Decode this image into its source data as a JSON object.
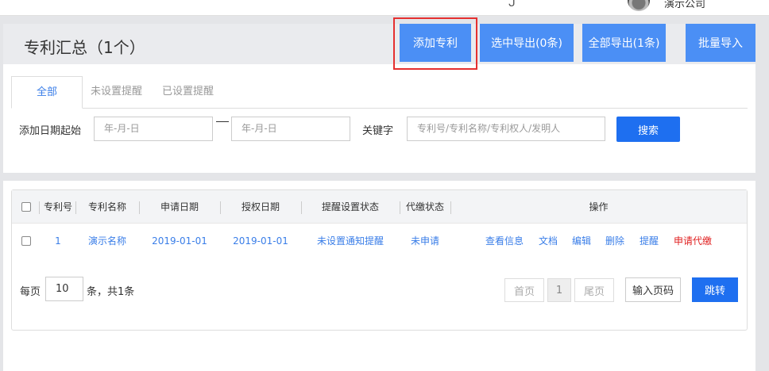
{
  "topbar": {
    "company": "演示公司"
  },
  "header": {
    "title": "专利汇总（1个）",
    "add_button": "添加专利",
    "export_selected": "选中导出(0条)",
    "export_all": "全部导出(1条)",
    "batch_import": "批量导入"
  },
  "tabs": [
    "全部",
    "未设置提醒",
    "已设置提醒"
  ],
  "filters": {
    "date_label": "添加日期起始",
    "date_from_placeholder": "年-月-日",
    "date_to_placeholder": "年-月-日",
    "keyword_label": "关键字",
    "keyword_placeholder": "专利号/专利名称/专利权人/发明人",
    "search_button": "搜索"
  },
  "table": {
    "columns": [
      "专利号",
      "专利名称",
      "申请日期",
      "授权日期",
      "提醒设置状态",
      "代缴状态",
      "操作"
    ],
    "rows": [
      {
        "number": "1",
        "name": "演示名称",
        "apply_date": "2019-01-01",
        "grant_date": "2019-01-01",
        "reminder_status": "未设置通知提醒",
        "payment_status": "未申请",
        "actions": [
          "查看信息",
          "文档",
          "编辑",
          "删除",
          "提醒",
          "申请代缴"
        ]
      }
    ]
  },
  "pagination": {
    "per_page_label": "每页",
    "per_page_value": "10",
    "total_label": "条，共1条",
    "first": "首页",
    "current": "1",
    "last": "尾页",
    "goto_placeholder": "输入页码",
    "jump": "跳转"
  },
  "colors": {
    "primary": "#4b8ff5",
    "search": "#1e6ff0",
    "link": "#3a7ee8",
    "danger": "#e02020",
    "highlight_border": "#e53030"
  }
}
